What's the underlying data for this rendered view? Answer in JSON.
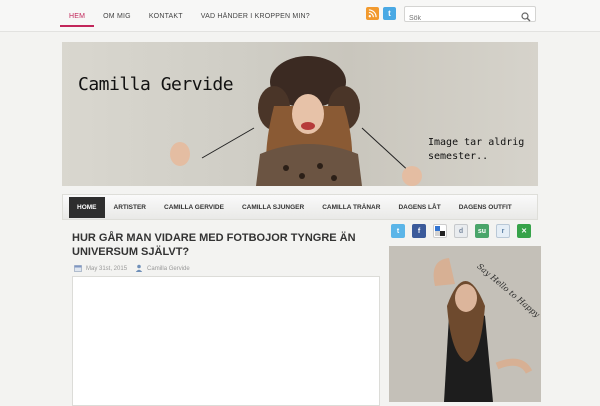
{
  "topnav": {
    "items": [
      {
        "label": "HEM",
        "active": true
      },
      {
        "label": "OM MIG"
      },
      {
        "label": "KONTAKT"
      },
      {
        "label": "VAD HÄNDER I KROPPEN MIN?"
      }
    ]
  },
  "search": {
    "placeholder": "Sök"
  },
  "header": {
    "title": "Camilla Gervide",
    "tagline_line1": "Image tar aldrig",
    "tagline_line2": "semester.."
  },
  "mainnav": {
    "items": [
      {
        "label": "HOME",
        "active": true
      },
      {
        "label": "ARTISTER"
      },
      {
        "label": "CAMILLA GERVIDE"
      },
      {
        "label": "CAMILLA SJUNGER"
      },
      {
        "label": "CAMILLA TRÄNAR"
      },
      {
        "label": "DAGENS LÅT"
      },
      {
        "label": "DAGENS OUTFIT"
      }
    ]
  },
  "post": {
    "title": "HUR GÅR MAN VIDARE MED FOTBOJOR TYNGRE ÄN UNIVERSUM SJÄLVT?",
    "date": "May 31st, 2015",
    "author": "Camilla Gervide"
  },
  "sidebar": {
    "photo_caption": "Say Hello to Happy"
  },
  "colors": {
    "accent": "#c2265a",
    "nav_active_bg": "#2e2e2e",
    "rss": "#f29a2e",
    "twitter": "#4aa9e4"
  }
}
